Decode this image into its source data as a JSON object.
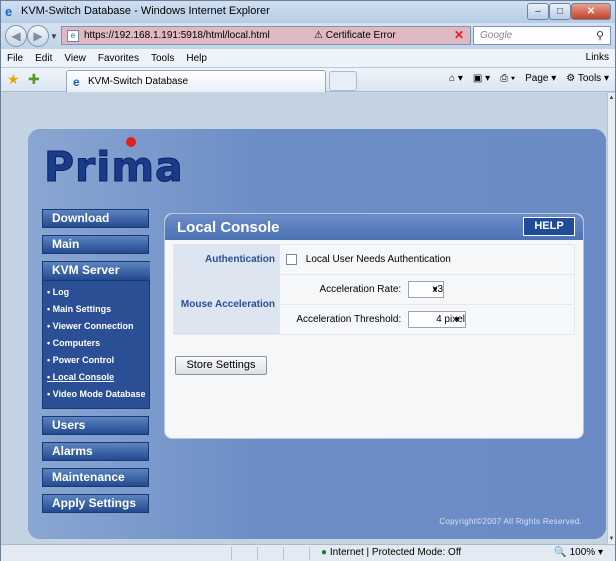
{
  "window": {
    "title": "KVM-Switch Database - Windows Internet Explorer"
  },
  "address_bar": {
    "url": "https://192.168.1.191:5918/html/local.html",
    "cert_error": "Certificate Error",
    "search_placeholder": "Google"
  },
  "menu": [
    "File",
    "Edit",
    "View",
    "Favorites",
    "Tools",
    "Help"
  ],
  "menu_links": "Links",
  "tab": {
    "label": "KVM-Switch Database"
  },
  "toolbar": {
    "page": "Page",
    "tools": "Tools"
  },
  "logo": {
    "text": "Prima"
  },
  "sidebar": {
    "download": "Download",
    "main": "Main",
    "kvm_server": "KVM Server",
    "sub_items": [
      "Log",
      "Main Settings",
      "Viewer Connection",
      "Computers",
      "Power Control",
      "Local Console",
      "Video Mode Database"
    ],
    "active_sub": "Local Console",
    "users": "Users",
    "alarms": "Alarms",
    "maintenance": "Maintenance",
    "apply": "Apply Settings"
  },
  "card": {
    "title": "Local Console",
    "help": "HELP",
    "auth_label": "Authentication",
    "auth_checkbox_label": "Local User Needs Authentication",
    "auth_checked": false,
    "mouse_label": "Mouse Acceleration",
    "accel_rate_label": "Acceleration Rate:",
    "accel_rate_value": "x3",
    "accel_threshold_label": "Acceleration Threshold:",
    "accel_threshold_value": "4 pixel",
    "store_button": "Store Settings"
  },
  "footer": {
    "copyright": "Copyright©2007 All Rights Reserved."
  },
  "status": {
    "zone": "Internet | Protected Mode: Off",
    "zoom": "100%"
  },
  "colors": {
    "accent": "#224a8f",
    "panel": "#6c8ec6",
    "logo": "#1a3a8a",
    "logo_dot": "#e0221a"
  }
}
